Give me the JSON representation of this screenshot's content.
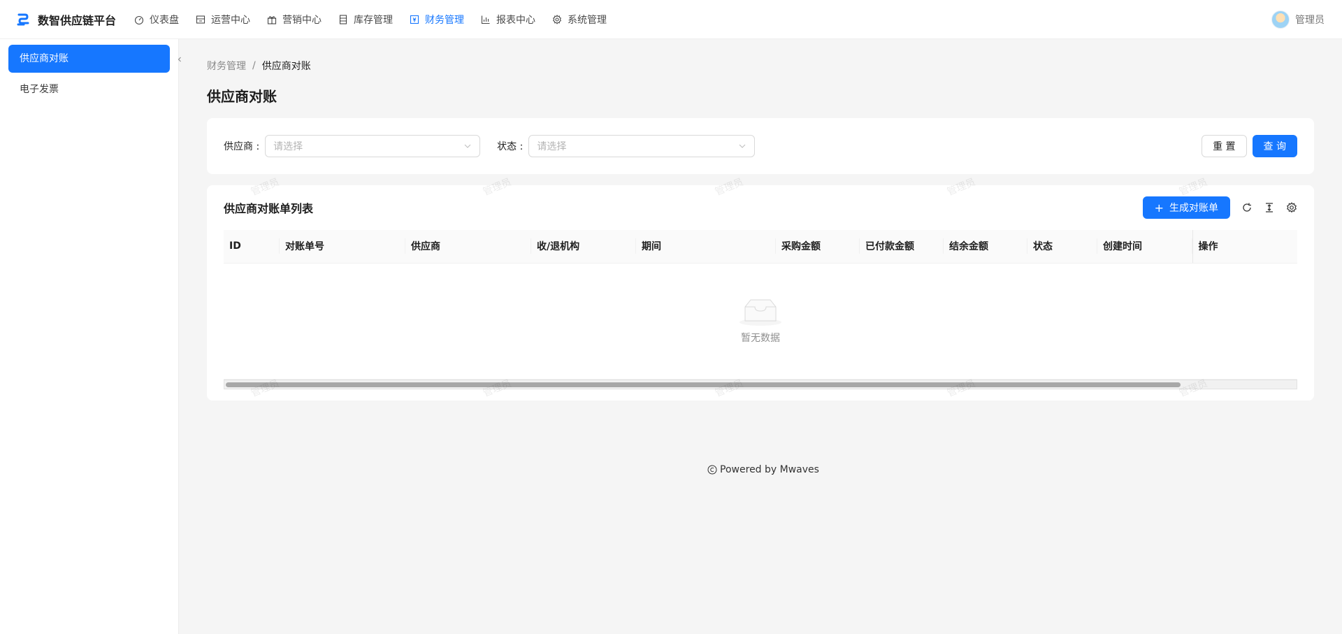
{
  "header": {
    "app_title": "数智供应链平台",
    "nav": [
      {
        "label": "仪表盘",
        "icon": "dashboard-icon",
        "active": false
      },
      {
        "label": "运营中心",
        "icon": "store-icon",
        "active": false
      },
      {
        "label": "营销中心",
        "icon": "gift-icon",
        "active": false
      },
      {
        "label": "库存管理",
        "icon": "database-icon",
        "active": false
      },
      {
        "label": "财务管理",
        "icon": "finance-icon",
        "active": true
      },
      {
        "label": "报表中心",
        "icon": "bar-chart-icon",
        "active": false
      },
      {
        "label": "系统管理",
        "icon": "gear-icon",
        "active": false
      }
    ],
    "user_name": "管理员"
  },
  "sidebar": {
    "items": [
      {
        "label": "供应商对账",
        "active": true
      },
      {
        "label": "电子发票",
        "active": false
      }
    ]
  },
  "breadcrumb": {
    "parent": "财务管理",
    "separator": "/",
    "current": "供应商对账"
  },
  "page_title": "供应商对账",
  "filters": {
    "supplier_label": "供应商 :",
    "supplier_placeholder": "请选择",
    "status_label": "状态 :",
    "status_placeholder": "请选择",
    "reset_label": "重 置",
    "query_label": "查 询"
  },
  "table": {
    "title": "供应商对账单列表",
    "create_label": "生成对账单",
    "columns": [
      "ID",
      "对账单号",
      "供应商",
      "收/退机构",
      "期间",
      "采购金额",
      "已付款金额",
      "结余金额",
      "状态",
      "创建时间",
      "操作"
    ],
    "empty_text": "暂无数据"
  },
  "watermark_text": "管理员",
  "footer": {
    "text": "Powered by Mwaves"
  },
  "colors": {
    "primary": "#1677ff",
    "background": "#f5f5f5"
  }
}
